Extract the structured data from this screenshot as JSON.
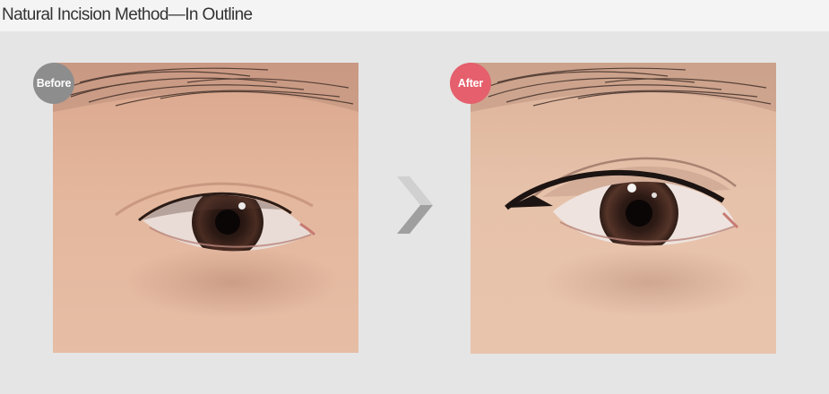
{
  "header": {
    "title": "Natural Incision Method—In Outline"
  },
  "before": {
    "badge_label": "Before",
    "badge_color": "#8d8d8d",
    "image_name": "eye-before-photo"
  },
  "after": {
    "badge_label": "After",
    "badge_color": "#e55f6c",
    "image_name": "eye-after-photo"
  },
  "arrow": {
    "icon": "chevron-right-icon"
  }
}
